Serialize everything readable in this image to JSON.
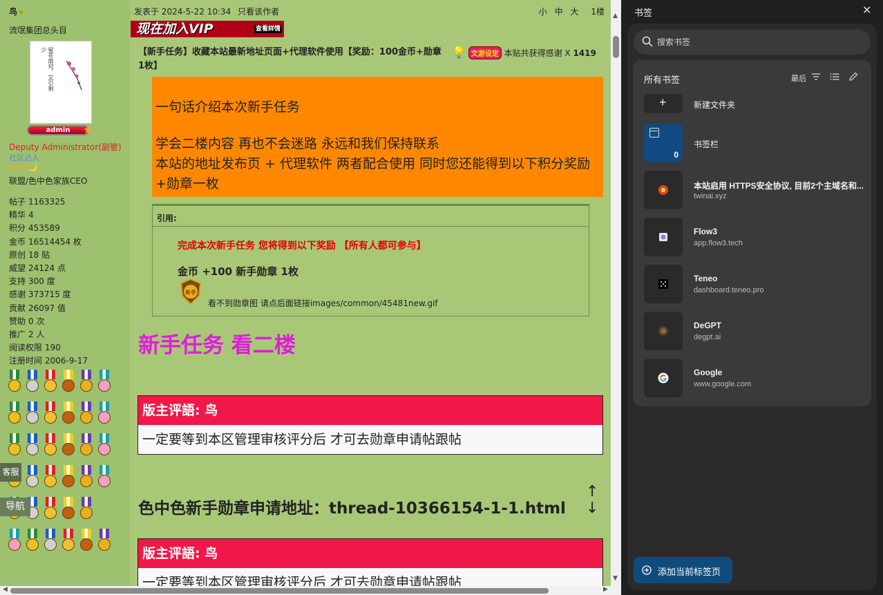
{
  "forum": {
    "user": {
      "name": "鸟",
      "title": "流氓集团总头目",
      "avatar_text": "留花扇何，又引剩少",
      "admin_badge": "admin",
      "role": "Deputy Administrator(副管)",
      "group": "社区达人",
      "smileys": "😊😊🌙",
      "affiliation": "联盟/色中色家族CEO",
      "stats": [
        {
          "k": "帖子",
          "v": "1163325"
        },
        {
          "k": "精华",
          "v": "4"
        },
        {
          "k": "积分",
          "v": "453589"
        },
        {
          "k": "金币",
          "v": "16514454 枚"
        },
        {
          "k": "原创",
          "v": "18 贴"
        },
        {
          "k": "威望",
          "v": "24124 点"
        },
        {
          "k": "支持",
          "v": "300 度"
        },
        {
          "k": "感谢",
          "v": "373715 度"
        },
        {
          "k": "贡献",
          "v": "26097 值"
        },
        {
          "k": "赞助",
          "v": "0 次"
        },
        {
          "k": "推广",
          "v": "2 人"
        },
        {
          "k": "阅读权限",
          "v": "190"
        },
        {
          "k": "注册时间",
          "v": "2006-9-17"
        }
      ]
    },
    "float_buttons": {
      "kefu": "客服",
      "daohang": "导航"
    },
    "post": {
      "posted_at": "发表于 2024-5-22 10:34",
      "only_author": "只看该作者",
      "font_small": "小",
      "font_mid": "中",
      "font_large": "大",
      "floor": "1楼",
      "vip_banner": "现在加入VIP",
      "vip_more": "查看詳情",
      "thread_title": "【新手任务】收藏本站最新地址页面+代理软件使用【奖励：100金币+勋章1枚】",
      "thanks_badge": "文游设定",
      "thanks_text": "本贴共获得感谢 X",
      "thanks_count": "1419",
      "orange_line1": "一句话介绍本次新手任务",
      "orange_line2": "学会二楼内容  再也不会迷路 永远和我们保持联系",
      "orange_line3": "本站的地址发布页 +  代理软件   两者配合使用  同时您还能得到以下积分奖励+勋章一枚",
      "quote_label": "引用:",
      "quote_red": "完成本次新手任务  您将得到以下奖励   【所有人都可参与】",
      "quote_reward": "金币 +100     新手勋章 1枚",
      "quote_medal_text": "新手",
      "quote_missing": "看不到勋章图 请点后面链接images/common/45481new.gif",
      "big_magenta": "新手任务  看二楼",
      "mod_head": "版主评語: 鸟",
      "mod_body": "一定要等到本区管理审核评分后  才可去勋章申请帖跟帖",
      "apply_line": "色中色新手勋章申请地址：thread-10366154-1-1.html",
      "updown": "↑↓"
    }
  },
  "panel": {
    "title": "书签",
    "search_placeholder": "搜索书签",
    "all_bookmarks": "所有书签",
    "sort_label": "最后",
    "new_folder": "新建文件夹",
    "bookmarks_bar": {
      "name": "书签栏",
      "count": "0"
    },
    "items": [
      {
        "name": "本站启用 HTTPS安全协议, 目前2个主域名和...",
        "url": "twinai.xyz",
        "icon": "twinai-favicon",
        "color": "#e04a1a"
      },
      {
        "name": "Flow3",
        "url": "app.flow3.tech",
        "icon": "flow3-favicon",
        "color": "#8a7ee0"
      },
      {
        "name": "Teneo",
        "url": "dashboard.teneo.pro",
        "icon": "teneo-favicon",
        "color": "#ffffff"
      },
      {
        "name": "DeGPT",
        "url": "degpt.ai",
        "icon": "degpt-favicon",
        "color": "#8a6a3a"
      },
      {
        "name": "Google",
        "url": "www.google.com",
        "icon": "google-favicon",
        "color": "#4285f4"
      }
    ],
    "add_current_tab": "添加当前标签页"
  }
}
